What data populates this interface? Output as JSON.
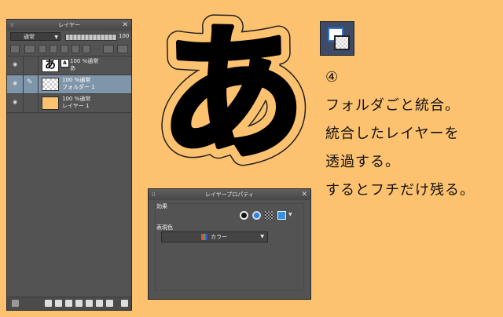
{
  "layer_panel": {
    "title": "レイヤー",
    "blend_mode": "通常",
    "opacity": "100",
    "layers": [
      {
        "name_line1": "100 %通常",
        "name_line2": "あ",
        "text_badge": "A",
        "thumb_text": "あ",
        "thumb": "text",
        "selected": false
      },
      {
        "name_line1": "100 %通常",
        "name_line2": "フォルダー 1",
        "thumb": "check",
        "selected": true
      },
      {
        "name_line1": "100 %通常",
        "name_line2": "レイヤー 1",
        "thumb": "orange",
        "selected": false
      }
    ]
  },
  "props_panel": {
    "title": "レイヤープロパティ",
    "effect_label": "効果",
    "expression_color_label": "表現色",
    "color_value": "カラー"
  },
  "canvas": {
    "glyph": "あ",
    "glyph_fill": "#000000",
    "glyph_outline": "#fdc26f"
  },
  "instructions": {
    "step": "④",
    "line1": "フォルダごと統合。",
    "line2": "統合したレイヤーを",
    "line3": "透過する。",
    "line4": "するとフチだけ残る。"
  },
  "colors": {
    "background": "#fdc26f",
    "panel": "#535353",
    "selected_row": "#7f95aa"
  }
}
